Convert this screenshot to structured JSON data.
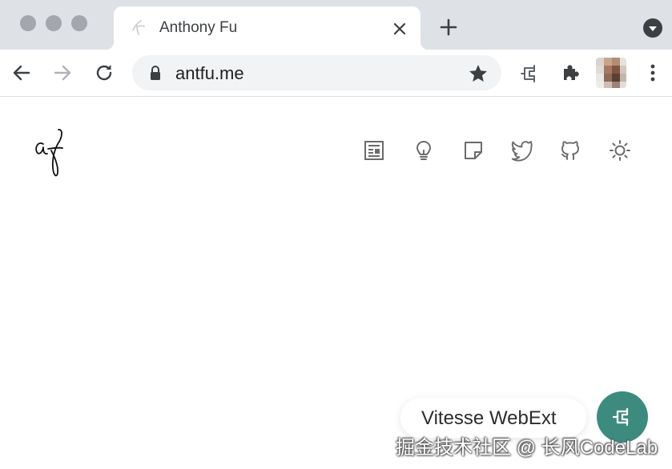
{
  "browser": {
    "tab": {
      "title": "Anthony Fu",
      "favicon": "af-logo-icon"
    },
    "toolbar": {
      "back": "arrow-left-icon",
      "forward": "arrow-right-icon",
      "reload": "reload-icon",
      "url": "antfu.me",
      "lock": "lock-icon",
      "bookmark": "star-icon",
      "extensions": [
        "plug-extension-icon",
        "puzzle-extensions-icon"
      ],
      "avatar": "profile-avatar",
      "menu": "more-vertical-icon"
    },
    "colors": {
      "tabstrip": "#dee1e6",
      "omnibox": "#f1f3f4",
      "accent": "#3d8b7f"
    }
  },
  "page": {
    "nav": [
      {
        "name": "blog",
        "icon": "article-icon"
      },
      {
        "name": "projects",
        "icon": "lightbulb-icon"
      },
      {
        "name": "notes",
        "icon": "sticky-note-icon"
      },
      {
        "name": "twitter",
        "icon": "twitter-icon"
      },
      {
        "name": "github",
        "icon": "github-icon"
      },
      {
        "name": "toggle-theme",
        "icon": "sun-icon"
      }
    ]
  },
  "extension": {
    "popup_label": "Vitesse WebExt"
  },
  "watermark": "掘金技术社区 @ 长风CodeLab"
}
